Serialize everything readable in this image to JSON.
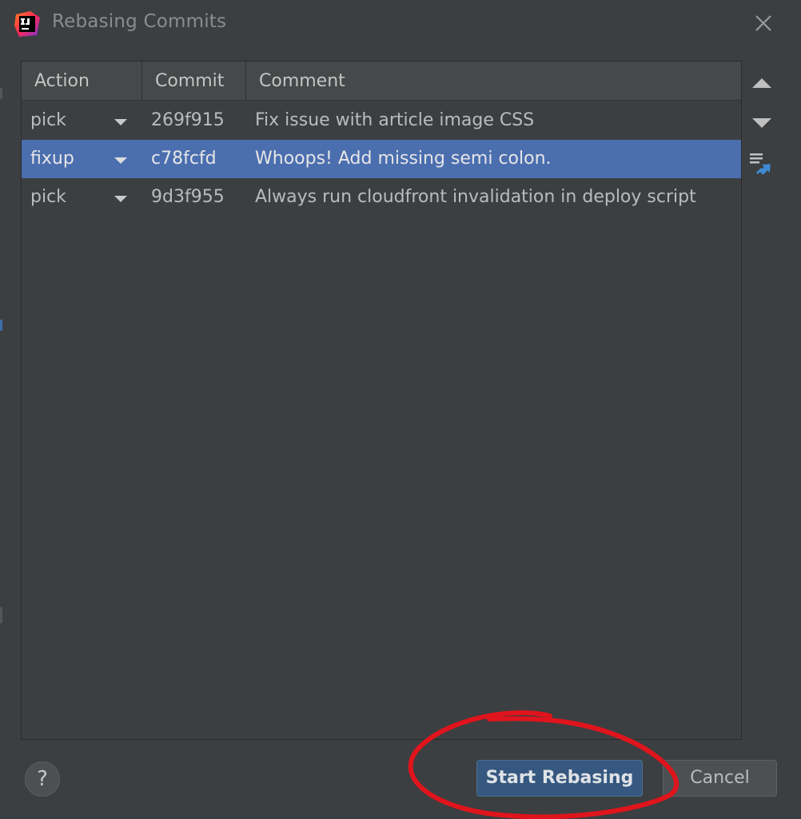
{
  "window": {
    "title": "Rebasing Commits"
  },
  "table": {
    "columns": [
      "Action",
      "Commit",
      "Comment"
    ],
    "rows": [
      {
        "action": "pick",
        "hash": "269f915",
        "comment": "Fix issue with article image CSS",
        "selected": false
      },
      {
        "action": "fixup",
        "hash": "c78fcfd",
        "comment": "Whoops! Add missing semi colon.",
        "selected": true
      },
      {
        "action": "pick",
        "hash": "9d3f955",
        "comment": "Always run cloudfront invalidation in deploy script",
        "selected": false
      }
    ]
  },
  "toolbar": {
    "icons": [
      "move-up-icon",
      "move-down-icon",
      "unite-commits-icon"
    ]
  },
  "footer": {
    "help_label": "?",
    "start_label": "Start Rebasing",
    "cancel_label": "Cancel"
  },
  "colors": {
    "background": "#3c3f41",
    "selection": "#4b6eaf",
    "primary_button": "#365880",
    "accent_blue": "#3d8bd4",
    "annotation_red": "#e0141c"
  }
}
